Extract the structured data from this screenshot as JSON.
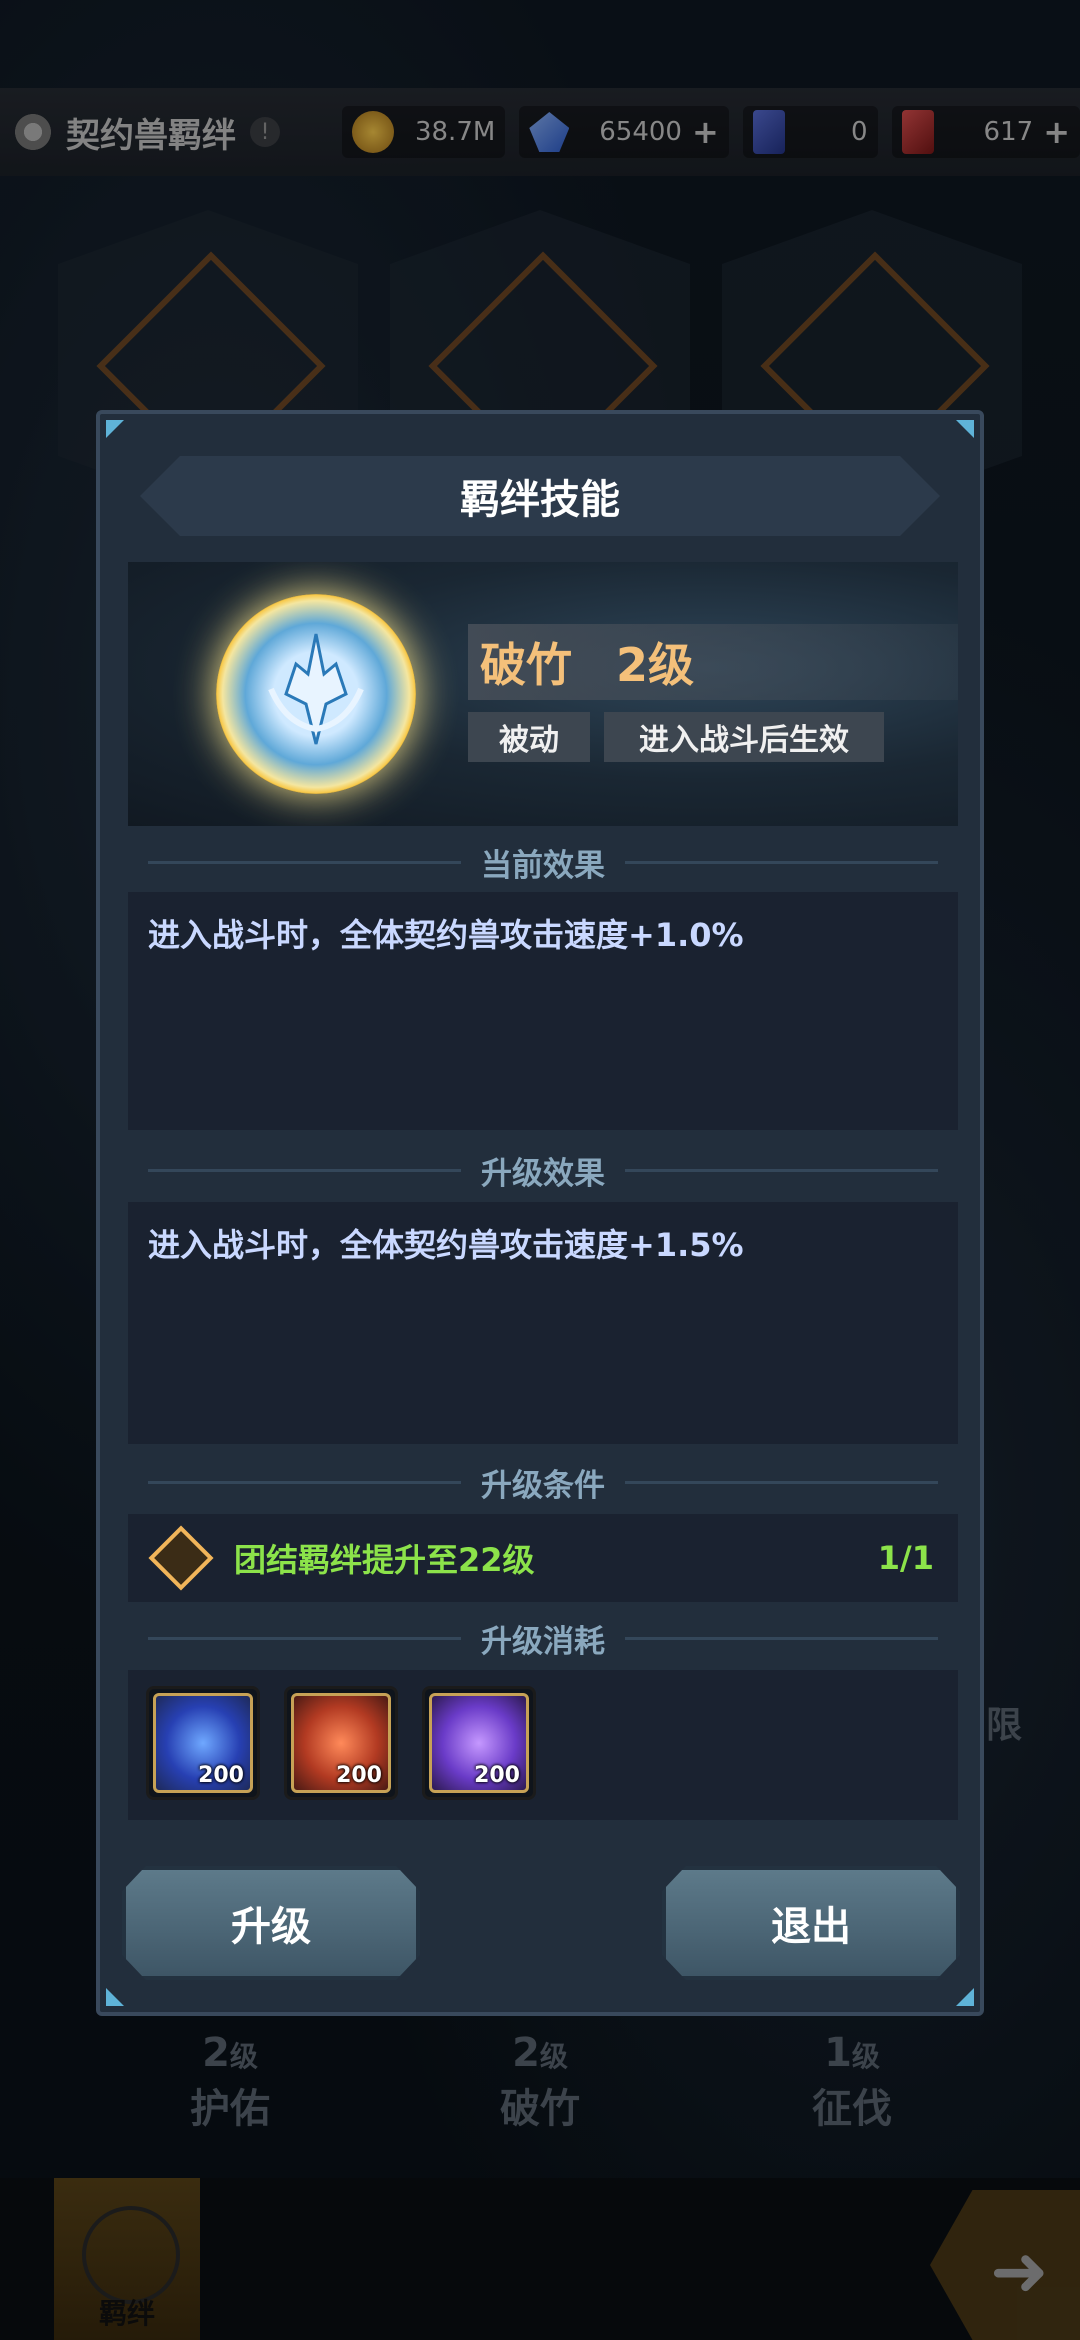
{
  "topbar": {
    "title": "契约兽羁绊",
    "resources": [
      {
        "icon": "coin-icon",
        "value": "38.7M",
        "plus": false
      },
      {
        "icon": "crystal-icon",
        "value": "65400",
        "plus": true
      },
      {
        "icon": "blue-ticket-icon",
        "value": "0",
        "plus": false
      },
      {
        "icon": "red-ticket-icon",
        "value": "617",
        "plus": true
      }
    ]
  },
  "background": {
    "bonds": [
      {
        "level": "2",
        "unit": "级",
        "name": "护佑"
      },
      {
        "level": "2",
        "unit": "级",
        "name": "破竹"
      },
      {
        "level": "1",
        "unit": "级",
        "name": "征伐"
      }
    ],
    "bottom_tab": "羁绊",
    "partial_text": "限"
  },
  "modal": {
    "title": "羁绊技能",
    "skill": {
      "name": "破竹",
      "level": "2级",
      "tags": [
        "被动",
        "进入战斗后生效"
      ]
    },
    "current_effect": {
      "heading": "当前效果",
      "text": "进入战斗时，全体契约兽攻击速度+1.0%"
    },
    "upgrade_effect": {
      "heading": "升级效果",
      "text": "进入战斗时，全体契约兽攻击速度+1.5%"
    },
    "condition": {
      "heading": "升级条件",
      "text": "团结羁绊提升至22级",
      "progress": "1/1"
    },
    "cost": {
      "heading": "升级消耗",
      "items": [
        {
          "icon": "blue-shield-emblem-icon",
          "qty": "200"
        },
        {
          "icon": "red-emblem-icon",
          "qty": "200"
        },
        {
          "icon": "purple-emblem-icon",
          "qty": "200"
        }
      ]
    },
    "buttons": {
      "upgrade": "升级",
      "exit": "退出"
    }
  },
  "colors": {
    "accent_gold": "#f4c07a",
    "condition_green": "#8ce34a",
    "effect_text": "#c9d8ff",
    "modal_bg": "#222e3c"
  }
}
